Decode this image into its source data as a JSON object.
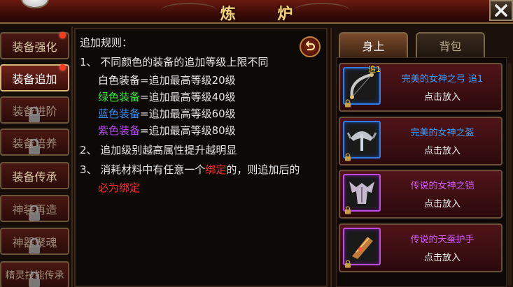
{
  "title": "炼 炉",
  "sidebar": {
    "items": [
      {
        "label": "装备强化",
        "dot": true,
        "locked": false,
        "active": false
      },
      {
        "label": "装备追加",
        "dot": true,
        "locked": false,
        "active": true
      },
      {
        "label": "装备进阶",
        "dot": false,
        "locked": true,
        "active": false
      },
      {
        "label": "装备培养",
        "dot": false,
        "locked": true,
        "active": false
      },
      {
        "label": "装备传承",
        "dot": false,
        "locked": false,
        "active": false
      },
      {
        "label": "神装再造",
        "dot": false,
        "locked": true,
        "active": false
      },
      {
        "label": "神器聚魂",
        "dot": false,
        "locked": true,
        "active": false
      },
      {
        "label": "精灵技能传承",
        "dot": false,
        "locked": true,
        "active": false
      }
    ]
  },
  "rules": {
    "heading": "追加规则：",
    "line1": "1、 不同颜色的装备的追加等级上限不同",
    "white": {
      "name": "白色装备",
      "text": "=追加最高等级20级"
    },
    "green": {
      "name": "绿色装备",
      "text": "=追加最高等级40级"
    },
    "blue": {
      "name": "蓝色装备",
      "text": "=追加最高等级60级"
    },
    "purple": {
      "name": "紫色装备",
      "text": "=追加最高等级80级"
    },
    "line2": "2、 追加级别越高属性提升越明显",
    "line3_pre": "3、 消耗材料中有任意一个",
    "line3_red": "绑定",
    "line3_post": "的，则追加后的",
    "line4_red": "必为绑定"
  },
  "tabs": {
    "body": "身上",
    "bag": "背包"
  },
  "items": [
    {
      "name": "完美的女神之弓 追1",
      "action": "点击放入",
      "badge": "追1",
      "quality": "blue",
      "icon": "bow-icon"
    },
    {
      "name": "完美的女神之盔",
      "action": "点击放入",
      "badge": "",
      "quality": "blue",
      "icon": "helmet-icon"
    },
    {
      "name": "传说的女神之铠",
      "action": "点击放入",
      "badge": "",
      "quality": "purple",
      "icon": "armor-icon"
    },
    {
      "name": "传说的天蚕护手",
      "action": "点击放入",
      "badge": "",
      "quality": "purple",
      "icon": "gauntlet-icon"
    }
  ],
  "colors": {
    "green": "#3fe23c",
    "blue": "#3a8ee8",
    "purple": "#b24ce8",
    "red": "#ff2a2a",
    "title_gold": "#f6d27a"
  }
}
